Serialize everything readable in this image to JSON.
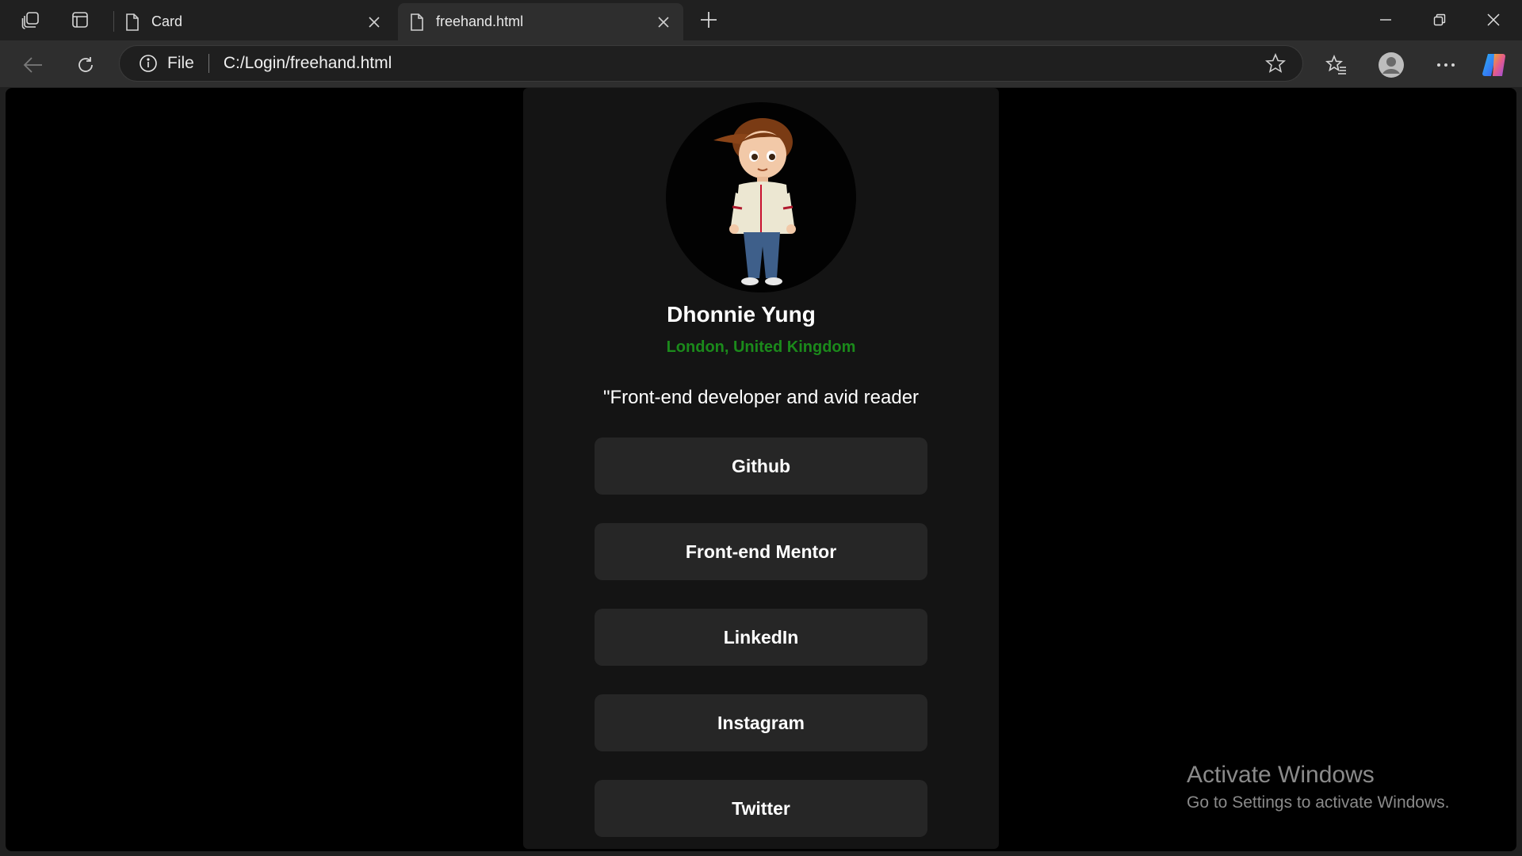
{
  "browser": {
    "tabs": [
      {
        "title": "Card",
        "active": false
      },
      {
        "title": "freehand.html",
        "active": true
      }
    ],
    "address": {
      "scheme_label": "File",
      "url": "C:/Login/freehand.html"
    }
  },
  "profile": {
    "name": "Dhonnie Yung",
    "location": "London, United Kingdom",
    "bio": "\"Front-end developer and avid reader",
    "links": [
      "Github",
      "Front-end Mentor",
      "LinkedIn",
      "Instagram",
      "Twitter"
    ]
  },
  "watermark": {
    "title": "Activate Windows",
    "subtitle": "Go to Settings to activate Windows."
  },
  "colors": {
    "location_accent": "#1b8a1b",
    "card_bg": "#141414",
    "button_bg": "#262626"
  }
}
